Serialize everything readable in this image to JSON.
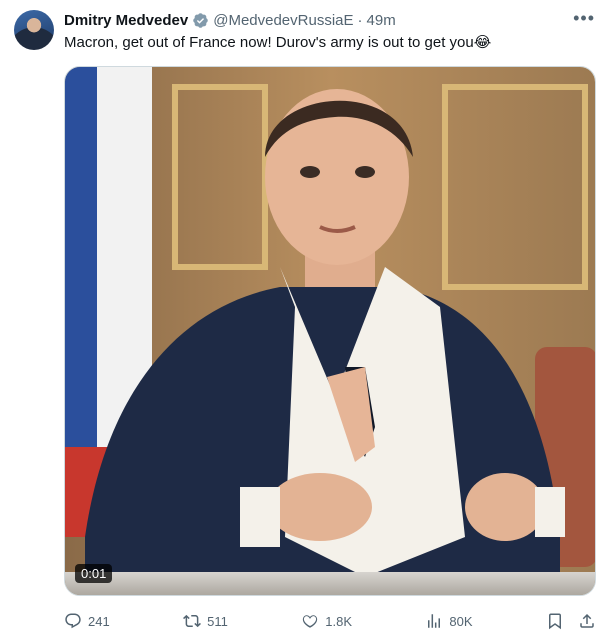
{
  "author": {
    "name": "Dmitry Medvedev",
    "handle": "@MedvedevRussiaE",
    "separator": "·",
    "time": "49m"
  },
  "tweet": {
    "text": "Macron, get out of France now! Durov's army is out to get you😂"
  },
  "media": {
    "timestamp": "0:01"
  },
  "actions": {
    "replies": "241",
    "reposts": "511",
    "likes": "1.8K",
    "views": "80K"
  },
  "icons": {
    "verified": "verified-badge-icon",
    "more": "more-icon",
    "reply": "reply-icon",
    "repost": "repost-icon",
    "like": "heart-icon",
    "views": "views-icon",
    "bookmark": "bookmark-icon",
    "share": "share-icon"
  },
  "colors": {
    "text": "#0f1419",
    "secondary": "#536471",
    "verified": "#1d9bf0"
  }
}
